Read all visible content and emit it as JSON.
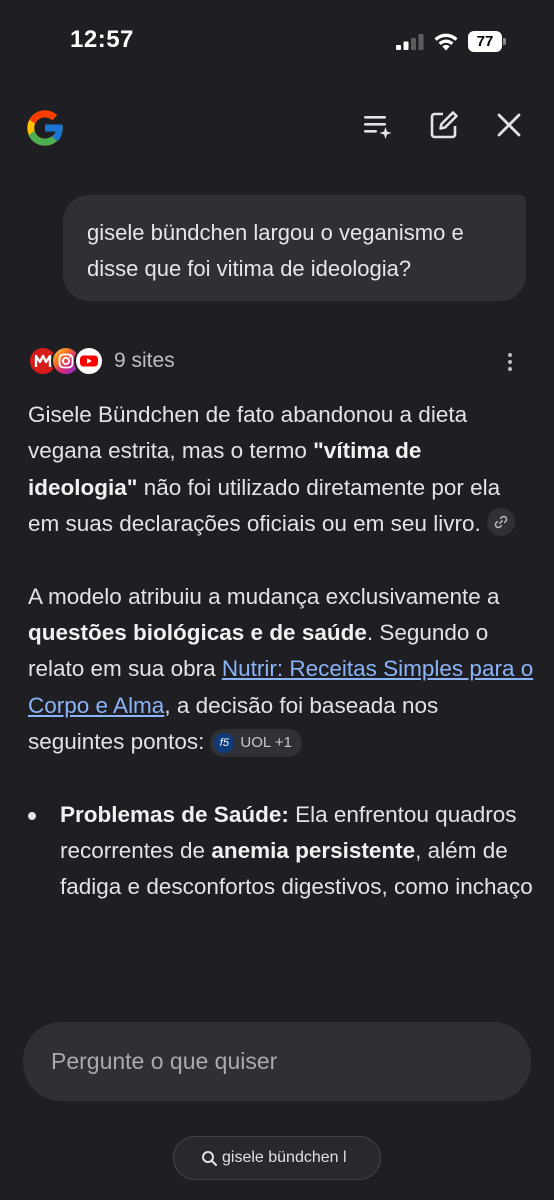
{
  "status_bar": {
    "time": "12:57",
    "battery": "77",
    "signal_icon": "cellular-signal-icon",
    "wifi_icon": "wifi-icon",
    "battery_icon": "battery-icon"
  },
  "header": {
    "logo_icon": "google-g-logo",
    "actions": [
      {
        "name": "queue-playlist-icon"
      },
      {
        "name": "new-chat-edit-icon"
      },
      {
        "name": "close-icon"
      }
    ]
  },
  "conversation": {
    "user_message": "gisele bündchen largou o veganismo e disse que foi vitima de ideologia?",
    "sources": {
      "count_label": "9 sites",
      "icons": [
        "metropoles-icon",
        "instagram-icon",
        "youtube-icon"
      ]
    },
    "answer": {
      "p1": {
        "t1": "Gisele Bündchen de fato abandonou a dieta vegana estrita, mas o termo ",
        "b1": "\"vítima de ideologia\"",
        "t2": " não foi utilizado diretamente por ela em suas declarações oficiais ou em seu livro."
      },
      "p2": {
        "t1": "A modelo atribuiu a mudança exclusivamente a ",
        "b1": "questões biológicas e de saúde",
        "t2": ". Segundo o relato em sua obra ",
        "link": "Nutrir: Receitas Simples para o Corpo e Alma",
        "t3": ", a decisão foi baseada nos seguintes pontos:",
        "chip_logo": "f5",
        "chip_label": "UOL +1"
      },
      "bullets": [
        {
          "b1": "Problemas de Saúde:",
          "t1": " Ela enfrentou quadros recorrentes de ",
          "b2": "anemia persistente",
          "t2": ", além de fadiga e desconfortos digestivos, como inchaço"
        }
      ]
    }
  },
  "input": {
    "placeholder": "Pergunte o que quiser"
  },
  "search_chip": {
    "label": "gisele bündchen l"
  },
  "colors": {
    "background": "#1f1f23",
    "bubble": "#2f3036",
    "link": "#8ab4f8",
    "text": "#e3e3e6"
  }
}
